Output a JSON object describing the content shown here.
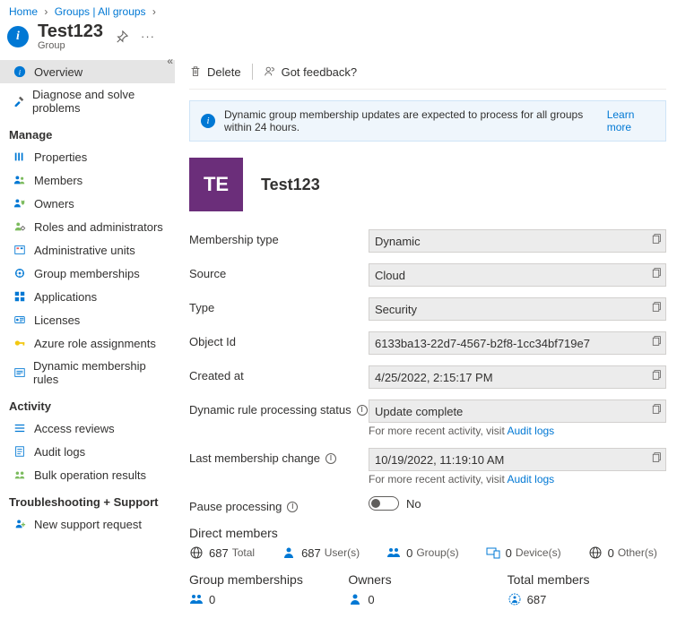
{
  "breadcrumb": {
    "home": "Home",
    "groups": "Groups | All groups"
  },
  "header": {
    "title": "Test123",
    "subtitle": "Group"
  },
  "toolbar": {
    "delete": "Delete",
    "feedback": "Got feedback?"
  },
  "banner": {
    "text": "Dynamic group membership updates are expected to process for all groups within 24 hours.",
    "learn": "Learn more"
  },
  "group": {
    "initials": "TE",
    "name": "Test123"
  },
  "sidebar": {
    "overview": "Overview",
    "diagnose": "Diagnose and solve problems",
    "manage_h": "Manage",
    "properties": "Properties",
    "members": "Members",
    "owners": "Owners",
    "roles": "Roles and administrators",
    "admin_units": "Administrative units",
    "group_memberships": "Group memberships",
    "applications": "Applications",
    "licenses": "Licenses",
    "azure_role": "Azure role assignments",
    "dynamic_rules": "Dynamic membership rules",
    "activity_h": "Activity",
    "access_reviews": "Access reviews",
    "audit_logs": "Audit logs",
    "bulk_results": "Bulk operation results",
    "trouble_h": "Troubleshooting + Support",
    "new_support": "New support request"
  },
  "props": {
    "membership_type": {
      "label": "Membership type",
      "value": "Dynamic"
    },
    "source": {
      "label": "Source",
      "value": "Cloud"
    },
    "type": {
      "label": "Type",
      "value": "Security"
    },
    "object_id": {
      "label": "Object Id",
      "value": "6133ba13-22d7-4567-b2f8-1cc34bf719e7"
    },
    "created_at": {
      "label": "Created at",
      "value": "4/25/2022, 2:15:17 PM"
    },
    "rule_status": {
      "label": "Dynamic rule processing status",
      "value": "Update complete",
      "help_prefix": "For more recent activity, visit ",
      "help_link": "Audit logs"
    },
    "last_change": {
      "label": "Last membership change",
      "value": "10/19/2022, 11:19:10 AM",
      "help_prefix": "For more recent activity, visit ",
      "help_link": "Audit logs"
    },
    "pause": {
      "label": "Pause processing",
      "value": "No"
    }
  },
  "direct": {
    "heading": "Direct members",
    "total": {
      "n": "687",
      "l": "Total"
    },
    "users": {
      "n": "687",
      "l": "User(s)"
    },
    "groups": {
      "n": "0",
      "l": "Group(s)"
    },
    "devices": {
      "n": "0",
      "l": "Device(s)"
    },
    "others": {
      "n": "0",
      "l": "Other(s)"
    }
  },
  "bottom": {
    "gm": {
      "heading": "Group memberships",
      "n": "0"
    },
    "owners": {
      "heading": "Owners",
      "n": "0"
    },
    "total": {
      "heading": "Total members",
      "n": "687"
    }
  }
}
